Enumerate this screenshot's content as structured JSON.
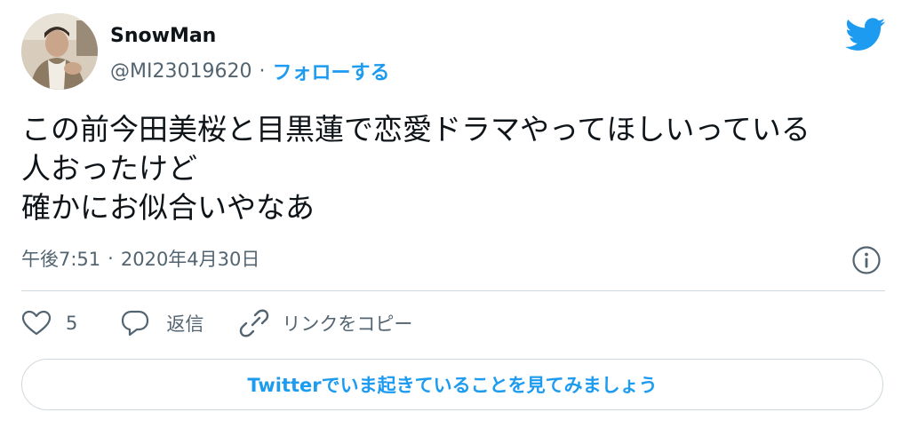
{
  "author": {
    "name": "SnowMan",
    "handle": "@MI23019620",
    "separator": "·",
    "follow_label": "フォローする",
    "avatar_icon": "user-photo-avatar"
  },
  "brand": {
    "icon": "twitter-bird-icon",
    "color": "#1d9bf0"
  },
  "tweet": {
    "lines": [
      "この前今田美桜と目黒蓮で恋愛ドラマやってほしいっている",
      "人おったけど",
      "確かにお似合いやなあ"
    ]
  },
  "meta": {
    "time": "午後7:51",
    "separator": "·",
    "date": "2020年4月30日",
    "info_icon": "info-icon"
  },
  "actions": {
    "like_icon": "heart-icon",
    "like_count": "5",
    "reply_icon": "reply-bubble-icon",
    "reply_label": "返信",
    "link_icon": "link-icon",
    "link_label": "リンクをコピー"
  },
  "cta": {
    "label": "Twitterでいま起きていることを見てみましょう"
  },
  "colors": {
    "accent": "#1d9bf0",
    "text": "#0f1419",
    "secondary": "#536471",
    "border": "#cfd9de"
  }
}
